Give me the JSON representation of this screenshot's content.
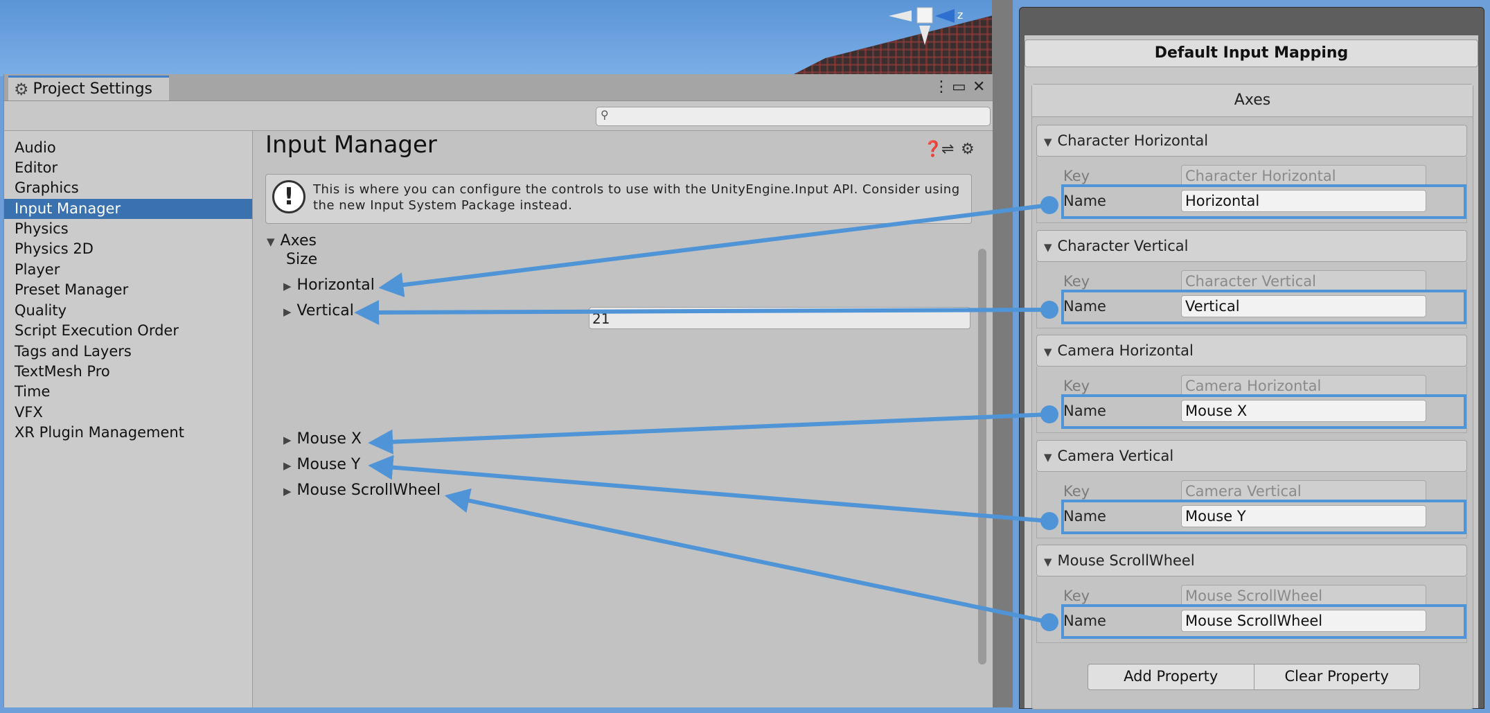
{
  "project_settings": {
    "tab_title": "Project Settings",
    "search_placeholder": "",
    "sidebar": [
      "Audio",
      "Editor",
      "Graphics",
      "Input Manager",
      "Physics",
      "Physics 2D",
      "Player",
      "Preset Manager",
      "Quality",
      "Script Execution Order",
      "Tags and Layers",
      "TextMesh Pro",
      "Time",
      "VFX",
      "XR Plugin Management"
    ],
    "selected_item": "Input Manager",
    "main": {
      "title": "Input Manager",
      "info": "This is where you can configure the controls to use with the UnityEngine.Input API. Consider using the new Input System Package instead.",
      "axes_label": "Axes",
      "size_label": "Size",
      "size_value": "21",
      "axes": [
        "Horizontal",
        "Vertical",
        "Mouse X",
        "Mouse Y",
        "Mouse ScrollWheel"
      ]
    }
  },
  "inspector": {
    "title": "Default Input Mapping",
    "axes_header": "Axes",
    "key_label": "Key",
    "name_label": "Name",
    "groups": [
      {
        "header": "Character Horizontal",
        "key": "Character Horizontal",
        "name": "Horizontal"
      },
      {
        "header": "Character Vertical",
        "key": "Character Vertical",
        "name": "Vertical"
      },
      {
        "header": "Camera Horizontal",
        "key": "Camera Horizontal",
        "name": "Mouse X"
      },
      {
        "header": "Camera Vertical",
        "key": "Camera Vertical",
        "name": "Mouse Y"
      },
      {
        "header": "Mouse ScrollWheel",
        "key": "Mouse ScrollWheel",
        "name": "Mouse ScrollWheel"
      }
    ],
    "buttons": {
      "add": "Add Property",
      "clear": "Clear Property"
    }
  },
  "gizmo_label": "z",
  "colors": {
    "accent": "#4f94d6",
    "selection": "#3a72b0"
  }
}
